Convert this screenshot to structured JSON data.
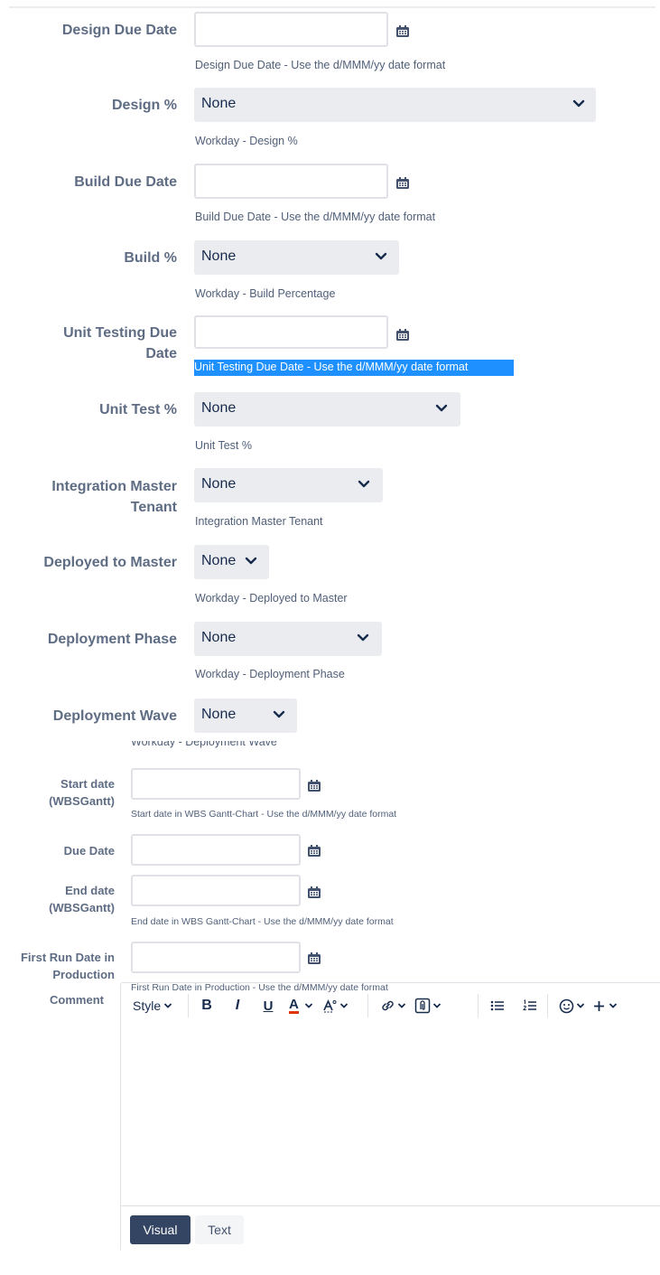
{
  "fields": {
    "design_due_date": {
      "label": "Design Due Date",
      "description": "Design Due Date - Use the d/MMM/yy date format"
    },
    "design_pct": {
      "label": "Design %",
      "value": "None",
      "description": "Workday - Design %"
    },
    "build_due_date": {
      "label": "Build Due Date",
      "description": "Build Due Date - Use the d/MMM/yy date format"
    },
    "build_pct": {
      "label": "Build %",
      "value": "None",
      "description": "Workday - Build Percentage"
    },
    "unit_testing_due_date": {
      "label_line1": "Unit Testing Due",
      "label_line2": "Date",
      "description": "Unit Testing Due Date - Use the d/MMM/yy date format"
    },
    "unit_test_pct": {
      "label": "Unit Test %",
      "value": "None",
      "description": "Unit Test %"
    },
    "integration_master_tenant": {
      "label_line1": "Integration Master",
      "label_line2": "Tenant",
      "value": "None",
      "description": "Integration Master Tenant"
    },
    "deployed_to_master": {
      "label": "Deployed to Master",
      "value": "None",
      "description": "Workday - Deployed to Master"
    },
    "deployment_phase": {
      "label": "Deployment Phase",
      "value": "None",
      "description": "Workday - Deployment Phase"
    },
    "deployment_wave": {
      "label": "Deployment Wave",
      "value": "None",
      "description": "Workday - Deployment Wave"
    },
    "start_date_wbs": {
      "label_line1": "Start date",
      "label_line2": "(WBSGantt)",
      "description": "Start date in WBS Gantt-Chart - Use the d/MMM/yy date format"
    },
    "due_date": {
      "label": "Due Date"
    },
    "end_date_wbs": {
      "label_line1": "End date",
      "label_line2": "(WBSGantt)",
      "description": "End date in WBS Gantt-Chart - Use the d/MMM/yy date format"
    },
    "first_run_date": {
      "label_line1": "First Run Date in",
      "label_line2": "Production",
      "description": "First Run Date in Production - Use the d/MMM/yy date format"
    }
  },
  "comment": {
    "label": "Comment",
    "toolbar": {
      "style": "Style",
      "bold": "B",
      "italic": "I",
      "underline": "U",
      "text_color": "A"
    },
    "modes": {
      "visual": "Visual",
      "text": "Text"
    }
  },
  "colors": {
    "accent": "#1e90ff",
    "label": "#5e6c84",
    "select_bg": "#ebecf0",
    "active_mode": "#344563",
    "text_color_underline": "#de350b"
  },
  "icons": [
    "calendar-icon",
    "chevron-down-icon",
    "link-icon",
    "attachment-icon",
    "bullet-list-icon",
    "numbered-list-icon",
    "emoji-icon",
    "plus-icon",
    "text-format-icon"
  ]
}
